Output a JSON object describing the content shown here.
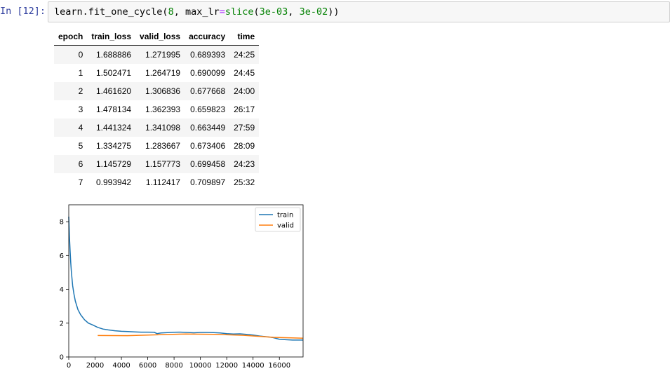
{
  "cell": {
    "prompt": "In [12]:",
    "code_func": "learn.fit_one_cycle(",
    "code_n": "8",
    "code_mid": ", max_lr",
    "code_eq": "=",
    "code_slice": "slice",
    "code_open": "(",
    "code_a": "3e-03",
    "code_sep": ", ",
    "code_b": "3e-02",
    "code_close": "))"
  },
  "results_table": {
    "columns": [
      "epoch",
      "train_loss",
      "valid_loss",
      "accuracy",
      "time"
    ],
    "rows": [
      [
        "0",
        "1.688886",
        "1.271995",
        "0.689393",
        "24:25"
      ],
      [
        "1",
        "1.502471",
        "1.264719",
        "0.690099",
        "24:45"
      ],
      [
        "2",
        "1.461620",
        "1.306836",
        "0.677668",
        "24:00"
      ],
      [
        "3",
        "1.478134",
        "1.362393",
        "0.659823",
        "26:17"
      ],
      [
        "4",
        "1.441324",
        "1.341098",
        "0.663449",
        "27:59"
      ],
      [
        "5",
        "1.334275",
        "1.283667",
        "0.673406",
        "28:09"
      ],
      [
        "6",
        "1.145729",
        "1.157773",
        "0.699458",
        "24:23"
      ],
      [
        "7",
        "0.993942",
        "1.112417",
        "0.709897",
        "25:32"
      ]
    ]
  },
  "chart_data": {
    "type": "line",
    "xlim": [
      0,
      17800
    ],
    "ylim": [
      0,
      9
    ],
    "xticks": [
      0,
      2000,
      4000,
      6000,
      8000,
      10000,
      12000,
      14000,
      16000
    ],
    "yticks": [
      0,
      2,
      4,
      6,
      8
    ],
    "grid": false,
    "legend_position": "top-right",
    "series": [
      {
        "name": "train",
        "color": "#1f77b4",
        "x": [
          0,
          50,
          100,
          150,
          200,
          300,
          400,
          500,
          700,
          900,
          1200,
          1500,
          1800,
          2200,
          2600,
          3000,
          3500,
          4000,
          4500,
          5000,
          5500,
          6000,
          6500,
          6700,
          7000,
          7500,
          8000,
          8500,
          9000,
          9500,
          10000,
          10500,
          11000,
          11500,
          12000,
          12500,
          13000,
          13500,
          14000,
          14500,
          15000,
          15500,
          16000,
          16500,
          17000,
          17800
        ],
        "y": [
          8.3,
          7.2,
          6.3,
          5.6,
          5.0,
          4.2,
          3.7,
          3.3,
          2.8,
          2.5,
          2.2,
          2.0,
          1.9,
          1.75,
          1.65,
          1.6,
          1.55,
          1.52,
          1.5,
          1.48,
          1.47,
          1.47,
          1.46,
          1.38,
          1.42,
          1.44,
          1.46,
          1.47,
          1.45,
          1.43,
          1.45,
          1.45,
          1.44,
          1.42,
          1.38,
          1.36,
          1.37,
          1.34,
          1.3,
          1.24,
          1.2,
          1.15,
          1.05,
          1.02,
          1.0,
          1.0
        ]
      },
      {
        "name": "valid",
        "color": "#ff7f0e",
        "x": [
          2200,
          4450,
          6700,
          8900,
          11100,
          13300,
          15550,
          17800
        ],
        "y": [
          1.27,
          1.26,
          1.31,
          1.36,
          1.34,
          1.28,
          1.16,
          1.11
        ]
      }
    ]
  }
}
